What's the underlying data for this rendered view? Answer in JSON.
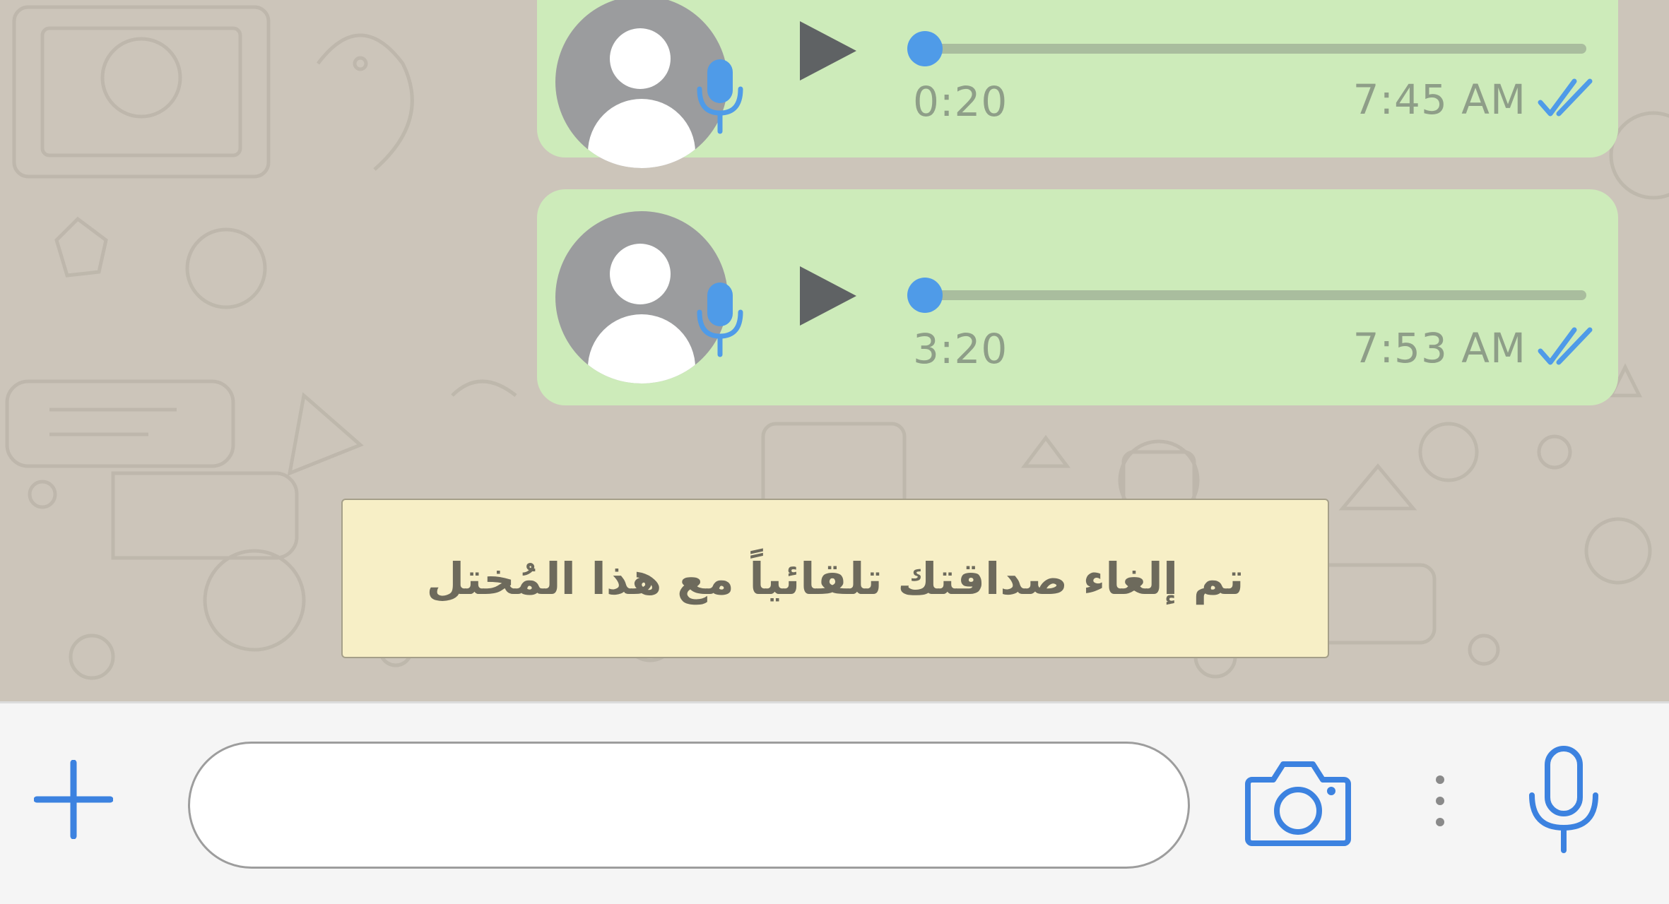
{
  "colors": {
    "chat_background": "#ccc5ba",
    "bubble_outgoing": "#cdebba",
    "accent_blue": "#4f9be8",
    "icon_blue": "#3c82e0",
    "notice_background": "#f7efc6"
  },
  "messages": [
    {
      "type": "voice",
      "avatar_icon": "default-avatar-icon",
      "badge_icon": "microphone-icon",
      "play_icon": "play-icon",
      "progress": 0,
      "duration": "0:20",
      "time": "7:45 AM",
      "status_icon": "double-check-read-icon"
    },
    {
      "type": "voice",
      "avatar_icon": "default-avatar-icon",
      "badge_icon": "microphone-icon",
      "play_icon": "play-icon",
      "progress": 0,
      "duration": "3:20",
      "time": "7:53 AM",
      "status_icon": "double-check-read-icon"
    }
  ],
  "system_notice": {
    "text": "تم إلغاء صداقتك تلقائياً مع هذا المُختل"
  },
  "input_bar": {
    "attach_icon": "plus-icon",
    "message_placeholder": "",
    "camera_icon": "camera-icon",
    "more_icon": "vertical-dots-icon",
    "voice_icon": "microphone-icon"
  }
}
